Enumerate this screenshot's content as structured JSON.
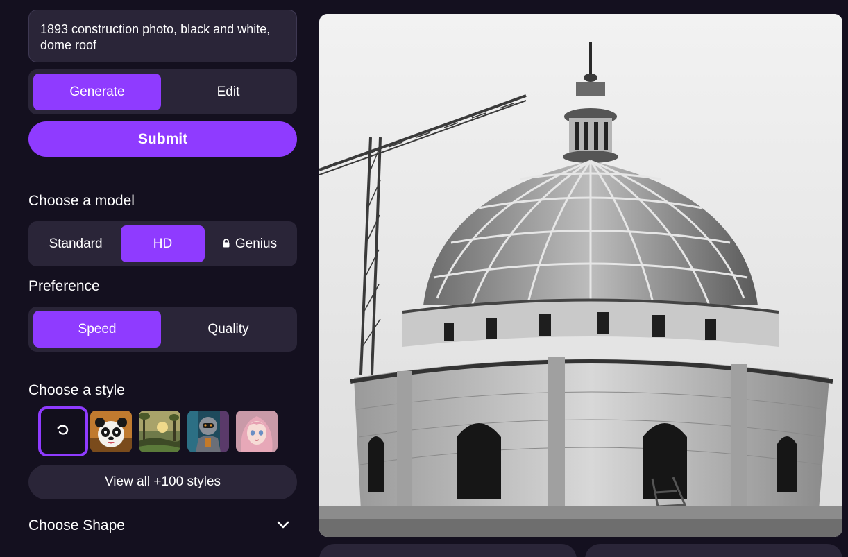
{
  "prompt": {
    "text": "1893 construction photo, black and white, dome roof"
  },
  "mode_tabs": [
    {
      "label": "Generate",
      "active": true
    },
    {
      "label": "Edit",
      "active": false
    }
  ],
  "submit_label": "Submit",
  "model": {
    "title": "Choose a model",
    "options": [
      {
        "label": "Standard",
        "active": false,
        "locked": false
      },
      {
        "label": "HD",
        "active": true,
        "locked": false
      },
      {
        "label": "Genius",
        "active": false,
        "locked": true
      }
    ]
  },
  "preference": {
    "title": "Preference",
    "options": [
      {
        "label": "Speed",
        "active": true
      },
      {
        "label": "Quality",
        "active": false
      }
    ]
  },
  "style": {
    "title": "Choose a style",
    "thumbnails": [
      {
        "name": "no-style-icon",
        "selected": true
      },
      {
        "name": "panda",
        "selected": false
      },
      {
        "name": "landscape",
        "selected": false
      },
      {
        "name": "robot",
        "selected": false
      },
      {
        "name": "anime-girl",
        "selected": false
      }
    ],
    "view_all_label": "View all +100 styles"
  },
  "shape": {
    "title": "Choose Shape"
  },
  "colors": {
    "accent": "#8f3bff",
    "background": "#14101f",
    "surface": "#2a2538"
  }
}
